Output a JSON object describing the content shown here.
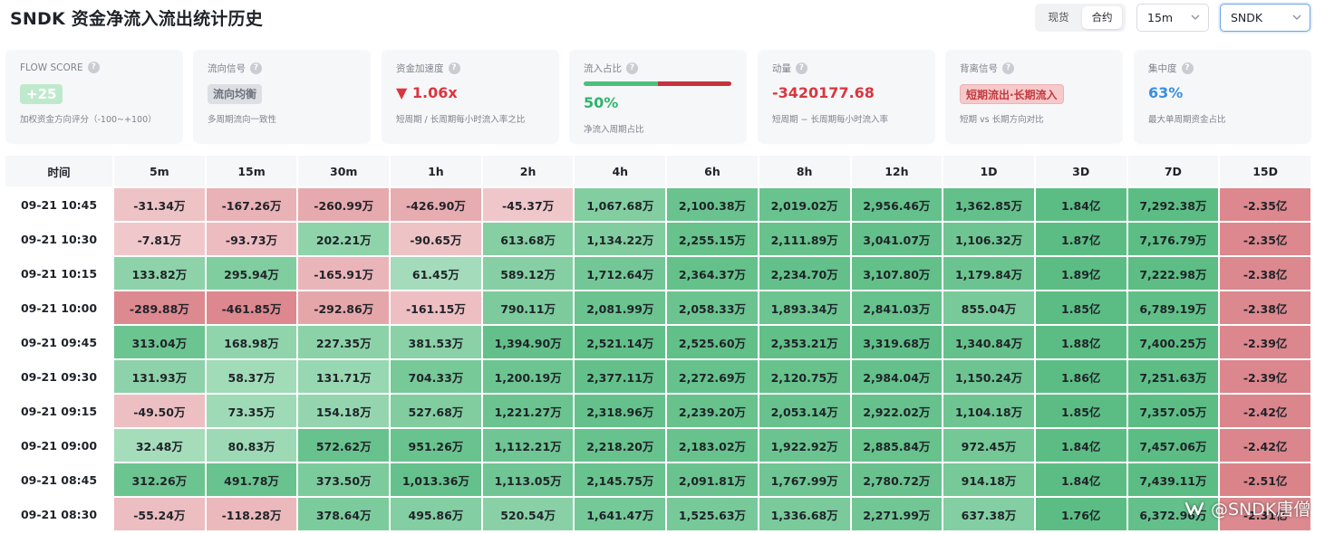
{
  "header": {
    "title": "SNDK 资金净流入流出统计历史",
    "market_tabs": [
      {
        "label": "现货",
        "active": false
      },
      {
        "label": "合约",
        "active": true
      }
    ],
    "interval_select": "15m",
    "symbol_select": "SNDK"
  },
  "cards": {
    "flow_score": {
      "label": "FLOW SCORE",
      "value": "+25",
      "desc": "加权资金方向评分（-100~+100）"
    },
    "flow_signal": {
      "label": "流向信号",
      "value": "流向均衡",
      "desc": "多周期流向一致性"
    },
    "acceleration": {
      "label": "资金加速度",
      "arrow": "▼",
      "value": "1.06x",
      "desc": "短周期 / 长周期每小时流入率之比"
    },
    "inflow_ratio": {
      "label": "流入占比",
      "value": "50%",
      "ratio": 0.5,
      "desc": "净流入周期占比"
    },
    "momentum": {
      "label": "动量",
      "value": "-3420177.68",
      "desc": "短周期 − 长周期每小时流入率"
    },
    "divergence": {
      "label": "背离信号",
      "value": "短期流出·长期流入",
      "desc": "短期 vs 长期方向对比"
    },
    "concentration": {
      "label": "集中度",
      "value": "63%",
      "desc": "最大单周期资金占比"
    }
  },
  "colors": {
    "positive_strong": "#5cbd84",
    "positive_light": "#cdeeda",
    "negative_strong": "#d6767d",
    "negative_light": "#f3d3d5",
    "value_red": "#d9363e",
    "value_green": "#2fb46c",
    "value_blue": "#3a8fe0"
  },
  "table": {
    "columns": [
      "时间",
      "5m",
      "15m",
      "30m",
      "1h",
      "2h",
      "4h",
      "6h",
      "8h",
      "12h",
      "1D",
      "3D",
      "7D",
      "15D"
    ],
    "rows": [
      {
        "time": "09-21 10:45",
        "cells": [
          "-31.34万",
          "-167.26万",
          "-260.99万",
          "-426.90万",
          "-45.37万",
          "1,067.68万",
          "2,100.38万",
          "2,019.02万",
          "2,956.46万",
          "1,362.85万",
          "1.84亿",
          "7,292.38万",
          "-2.35亿"
        ]
      },
      {
        "time": "09-21 10:30",
        "cells": [
          "-7.81万",
          "-93.73万",
          "202.21万",
          "-90.65万",
          "613.68万",
          "1,134.22万",
          "2,255.15万",
          "2,111.89万",
          "3,041.07万",
          "1,106.32万",
          "1.87亿",
          "7,176.79万",
          "-2.35亿"
        ]
      },
      {
        "time": "09-21 10:15",
        "cells": [
          "133.82万",
          "295.94万",
          "-165.91万",
          "61.45万",
          "589.12万",
          "1,712.64万",
          "2,364.37万",
          "2,234.70万",
          "3,107.80万",
          "1,179.84万",
          "1.89亿",
          "7,222.98万",
          "-2.38亿"
        ]
      },
      {
        "time": "09-21 10:00",
        "cells": [
          "-289.88万",
          "-461.85万",
          "-292.86万",
          "-161.15万",
          "790.11万",
          "2,081.99万",
          "2,058.33万",
          "1,893.34万",
          "2,841.03万",
          "855.04万",
          "1.85亿",
          "6,789.19万",
          "-2.38亿"
        ]
      },
      {
        "time": "09-21 09:45",
        "cells": [
          "313.04万",
          "168.98万",
          "227.35万",
          "381.53万",
          "1,394.90万",
          "2,521.14万",
          "2,525.60万",
          "2,353.21万",
          "3,319.68万",
          "1,340.84万",
          "1.88亿",
          "7,400.25万",
          "-2.39亿"
        ]
      },
      {
        "time": "09-21 09:30",
        "cells": [
          "131.93万",
          "58.37万",
          "131.71万",
          "704.33万",
          "1,200.19万",
          "2,377.11万",
          "2,272.69万",
          "2,120.75万",
          "2,984.04万",
          "1,150.24万",
          "1.86亿",
          "7,251.63万",
          "-2.39亿"
        ]
      },
      {
        "time": "09-21 09:15",
        "cells": [
          "-49.50万",
          "73.35万",
          "154.18万",
          "527.68万",
          "1,221.27万",
          "2,318.96万",
          "2,239.20万",
          "2,053.14万",
          "2,922.02万",
          "1,104.18万",
          "1.85亿",
          "7,357.05万",
          "-2.42亿"
        ]
      },
      {
        "time": "09-21 09:00",
        "cells": [
          "32.48万",
          "80.83万",
          "572.62万",
          "951.26万",
          "1,112.21万",
          "2,218.20万",
          "2,183.02万",
          "1,922.92万",
          "2,885.84万",
          "972.45万",
          "1.84亿",
          "7,457.06万",
          "-2.42亿"
        ]
      },
      {
        "time": "09-21 08:45",
        "cells": [
          "312.26万",
          "491.78万",
          "373.50万",
          "1,013.36万",
          "1,113.05万",
          "2,145.75万",
          "2,091.81万",
          "1,767.99万",
          "2,780.72万",
          "914.18万",
          "1.84亿",
          "7,439.11万",
          "-2.51亿"
        ]
      },
      {
        "time": "09-21 08:30",
        "cells": [
          "-55.24万",
          "-118.28万",
          "378.64万",
          "495.86万",
          "520.54万",
          "1,641.47万",
          "1,525.63万",
          "1,336.68万",
          "2,271.99万",
          "637.38万",
          "1.76亿",
          "6,372.96万",
          "-2.31亿"
        ]
      }
    ]
  },
  "watermark": "@SNDK唐僧"
}
